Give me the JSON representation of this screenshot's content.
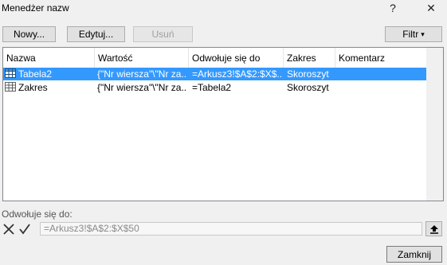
{
  "window": {
    "title": "Menedżer nazw",
    "help": "?",
    "close": "✕"
  },
  "toolbar": {
    "new": "Nowy...",
    "edit": "Edytuj...",
    "delete": "Usuń",
    "filter": "Filtr",
    "filter_arrow": "▾"
  },
  "table": {
    "columns": [
      "Nazwa",
      "Wartość",
      "Odwołuje się do",
      "Zakres",
      "Komentarz"
    ],
    "rows": [
      {
        "name": "Tabela2",
        "value": "{\"Nr wiersza\"\\\"Nr za...",
        "refers_to": "=Arkusz3!$A$2:$X$...",
        "scope": "Skoroszyt",
        "comment": "",
        "selected": true
      },
      {
        "name": "Zakres",
        "value": "{\"Nr wiersza\"\\\"Nr za...",
        "refers_to": "=Tabela2",
        "scope": "Skoroszyt",
        "comment": "",
        "selected": false
      }
    ]
  },
  "refers_to": {
    "label": "Odwołuje się do:",
    "value": "=Arkusz3!$A$2:$X$50"
  },
  "footer": {
    "close": "Zamknij"
  },
  "colors": {
    "selection": "#3399ff",
    "background": "#f0f0f0"
  }
}
